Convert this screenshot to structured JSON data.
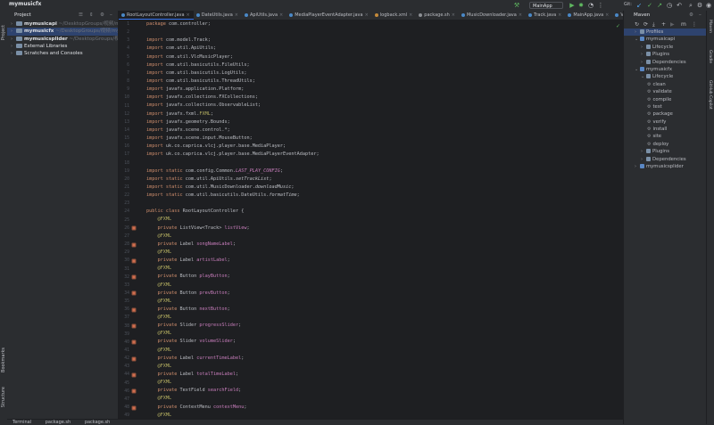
{
  "window": {
    "title": "mymusicfx"
  },
  "toolbar": {
    "run_config": "MainApp",
    "git_label": "Git:"
  },
  "left_strip": {
    "project": "Project",
    "structure": "Structure",
    "bookmarks": "Bookmarks"
  },
  "project_panel": {
    "header": "Project",
    "items": [
      {
        "name": "mymusicapi",
        "path": " ~/DesktopGroups/视频/mym",
        "indent": 0,
        "expanded": false,
        "selected": false
      },
      {
        "name": "mymusicfx",
        "path": " ~/DesktopGroups/视频/mym",
        "indent": 0,
        "expanded": false,
        "selected": true
      },
      {
        "name": "mymusicsplider",
        "path": " ~/DesktopGroups/视频/m",
        "indent": 0,
        "expanded": false,
        "selected": false
      },
      {
        "name": "External Libraries",
        "path": "",
        "indent": 0,
        "expanded": false,
        "selected": false
      },
      {
        "name": "Scratches and Consoles",
        "path": "",
        "indent": 0,
        "expanded": false,
        "selected": false
      }
    ]
  },
  "tabs": [
    {
      "label": "RootLayoutController.java",
      "active": true,
      "color": "#4a88c7"
    },
    {
      "label": "DateUtils.java",
      "active": false,
      "color": "#4a88c7"
    },
    {
      "label": "ApiUtils.java",
      "active": false,
      "color": "#4a88c7"
    },
    {
      "label": "MediaPlayerEventAdapter.java",
      "active": false,
      "color": "#4a88c7"
    },
    {
      "label": "logback.xml",
      "active": false,
      "color": "#c58a3a"
    },
    {
      "label": "package.sh",
      "active": false,
      "color": "#8c8f94"
    },
    {
      "label": "MusicDownloader.java",
      "active": false,
      "color": "#4a88c7"
    },
    {
      "label": "Track.java",
      "active": false,
      "color": "#4a88c7"
    },
    {
      "label": "MainApp.java",
      "active": false,
      "color": "#4a88c7"
    },
    {
      "label": "VlcMusic",
      "active": false,
      "color": "#4a88c7"
    }
  ],
  "code_lines": [
    {
      "n": "1",
      "html": "<span class=\"kw\">package</span> com.controller;"
    },
    {
      "n": "2",
      "html": ""
    },
    {
      "n": "3",
      "html": "<span class=\"kw\">import</span> com.model.Track;"
    },
    {
      "n": "4",
      "html": "<span class=\"kw\">import</span> com.util.ApiUtils;"
    },
    {
      "n": "5",
      "html": "<span class=\"kw\">import</span> com.util.VlcMusicPlayer;"
    },
    {
      "n": "6",
      "html": "<span class=\"kw\">import</span> com.util.basicutils.FileUtils;"
    },
    {
      "n": "7",
      "html": "<span class=\"kw\">import</span> com.util.basicutils.LogUtils;"
    },
    {
      "n": "8",
      "html": "<span class=\"kw\">import</span> com.util.basicutils.ThreadUtils;"
    },
    {
      "n": "9",
      "html": "<span class=\"kw\">import</span> javafx.application.Platform;"
    },
    {
      "n": "10",
      "html": "<span class=\"kw\">import</span> javafx.collections.FXCollections;"
    },
    {
      "n": "11",
      "html": "<span class=\"kw\">import</span> javafx.collections.ObservableList;"
    },
    {
      "n": "12",
      "html": "<span class=\"kw\">import</span> javafx.fxml.<span class=\"ann\">FXML</span>;"
    },
    {
      "n": "13",
      "html": "<span class=\"kw\">import</span> javafx.geometry.Bounds;"
    },
    {
      "n": "14",
      "html": "<span class=\"kw\">import</span> javafx.scene.control.*;"
    },
    {
      "n": "15",
      "html": "<span class=\"kw\">import</span> javafx.scene.input.MouseButton;"
    },
    {
      "n": "16",
      "html": "<span class=\"kw\">import</span> uk.co.caprica.vlcj.player.base.MediaPlayer;"
    },
    {
      "n": "17",
      "html": "<span class=\"kw\">import</span> uk.co.caprica.vlcj.player.base.MediaPlayerEventAdapter;"
    },
    {
      "n": "18",
      "html": ""
    },
    {
      "n": "19",
      "html": "<span class=\"kw\">import static</span> com.config.Common.<span class=\"fld ital\">LAST_PLAY_CONFIG</span>;"
    },
    {
      "n": "20",
      "html": "<span class=\"kw\">import static</span> com.util.ApiUtils.<span class=\"ital\">setTrackList</span>;"
    },
    {
      "n": "21",
      "html": "<span class=\"kw\">import static</span> com.util.MusicDownloader.<span class=\"ital\">downloadMusic</span>;"
    },
    {
      "n": "22",
      "html": "<span class=\"kw\">import static</span> com.util.basicutils.DateUtils.<span class=\"ital\">formatTime</span>;"
    },
    {
      "n": "23",
      "html": ""
    },
    {
      "n": "24",
      "html": "<span class=\"kw\">public class</span> RootLayoutController {"
    },
    {
      "n": "25",
      "html": "    <span class=\"ann\">@FXML</span>"
    },
    {
      "n": "26",
      "html": "    <span class=\"kw\">private</span> ListView&lt;Track&gt; <span class=\"fld\">listView</span>;",
      "icon": true
    },
    {
      "n": "27",
      "html": "    <span class=\"ann\">@FXML</span>"
    },
    {
      "n": "28",
      "html": "    <span class=\"kw\">private</span> Label <span class=\"fld\">songNameLabel</span>;",
      "icon": true
    },
    {
      "n": "29",
      "html": "    <span class=\"ann\">@FXML</span>"
    },
    {
      "n": "30",
      "html": "    <span class=\"kw\">private</span> Label <span class=\"fld\">artistLabel</span>;",
      "icon": true
    },
    {
      "n": "31",
      "html": "    <span class=\"ann\">@FXML</span>"
    },
    {
      "n": "32",
      "html": "    <span class=\"kw\">private</span> Button <span class=\"fld\">playButton</span>;",
      "icon": true
    },
    {
      "n": "33",
      "html": "    <span class=\"ann\">@FXML</span>"
    },
    {
      "n": "34",
      "html": "    <span class=\"kw\">private</span> Button <span class=\"fld\">prevButton</span>;",
      "icon": true
    },
    {
      "n": "35",
      "html": "    <span class=\"ann\">@FXML</span>"
    },
    {
      "n": "36",
      "html": "    <span class=\"kw\">private</span> Button <span class=\"fld\">nextButton</span>;",
      "icon": true
    },
    {
      "n": "37",
      "html": "    <span class=\"ann\">@FXML</span>"
    },
    {
      "n": "38",
      "html": "    <span class=\"kw\">private</span> Slider <span class=\"fld\">progressSlider</span>;",
      "icon": true
    },
    {
      "n": "39",
      "html": "    <span class=\"ann\">@FXML</span>"
    },
    {
      "n": "40",
      "html": "    <span class=\"kw\">private</span> Slider <span class=\"fld\">volumeSlider</span>;",
      "icon": true
    },
    {
      "n": "41",
      "html": "    <span class=\"ann\">@FXML</span>"
    },
    {
      "n": "42",
      "html": "    <span class=\"kw\">private</span> Label <span class=\"fld\">currentTimeLabel</span>;",
      "icon": true
    },
    {
      "n": "43",
      "html": "    <span class=\"ann\">@FXML</span>"
    },
    {
      "n": "44",
      "html": "    <span class=\"kw\">private</span> Label <span class=\"fld\">totalTimeLabel</span>;",
      "icon": true
    },
    {
      "n": "45",
      "html": "    <span class=\"ann\">@FXML</span>"
    },
    {
      "n": "46",
      "html": "    <span class=\"kw\">private</span> TextField <span class=\"fld\">searchField</span>;",
      "icon": true
    },
    {
      "n": "47",
      "html": "    <span class=\"ann\">@FXML</span>"
    },
    {
      "n": "48",
      "html": "    <span class=\"kw\">private</span> ContextMenu <span class=\"fld\">contextMenu</span>;",
      "icon": true
    },
    {
      "n": "49",
      "html": "    <span class=\"ann\">@FXML</span>"
    }
  ],
  "maven": {
    "header": "Maven",
    "items": [
      {
        "label": "Profiles",
        "indent": 0,
        "arrow": "›",
        "kind": "folder",
        "selected": true
      },
      {
        "label": "mymusicapi",
        "indent": 0,
        "arrow": "⌄",
        "kind": "module",
        "selected": false
      },
      {
        "label": "Lifecycle",
        "indent": 1,
        "arrow": "›",
        "kind": "folder",
        "selected": false
      },
      {
        "label": "Plugins",
        "indent": 1,
        "arrow": "›",
        "kind": "folder",
        "selected": false
      },
      {
        "label": "Dependencies",
        "indent": 1,
        "arrow": "›",
        "kind": "folder",
        "selected": false
      },
      {
        "label": "mymusicfx",
        "indent": 0,
        "arrow": "⌄",
        "kind": "module",
        "selected": false
      },
      {
        "label": "Lifecycle",
        "indent": 1,
        "arrow": "⌄",
        "kind": "folder",
        "selected": false
      },
      {
        "label": "clean",
        "indent": 2,
        "arrow": "",
        "kind": "goal",
        "selected": false
      },
      {
        "label": "validate",
        "indent": 2,
        "arrow": "",
        "kind": "goal",
        "selected": false
      },
      {
        "label": "compile",
        "indent": 2,
        "arrow": "",
        "kind": "goal",
        "selected": false
      },
      {
        "label": "test",
        "indent": 2,
        "arrow": "",
        "kind": "goal",
        "selected": false
      },
      {
        "label": "package",
        "indent": 2,
        "arrow": "",
        "kind": "goal",
        "selected": false
      },
      {
        "label": "verify",
        "indent": 2,
        "arrow": "",
        "kind": "goal",
        "selected": false
      },
      {
        "label": "install",
        "indent": 2,
        "arrow": "",
        "kind": "goal",
        "selected": false
      },
      {
        "label": "site",
        "indent": 2,
        "arrow": "",
        "kind": "goal",
        "selected": false
      },
      {
        "label": "deploy",
        "indent": 2,
        "arrow": "",
        "kind": "goal",
        "selected": false
      },
      {
        "label": "Plugins",
        "indent": 1,
        "arrow": "›",
        "kind": "folder",
        "selected": false
      },
      {
        "label": "Dependencies",
        "indent": 1,
        "arrow": "›",
        "kind": "folder",
        "selected": false
      },
      {
        "label": "mymusicsplider",
        "indent": 0,
        "arrow": "›",
        "kind": "module",
        "selected": false
      }
    ]
  },
  "right_strip": {
    "maven": "Maven",
    "gradle": "Gradle",
    "github": "GitHub Copilot"
  },
  "bottom_bar": {
    "terminal": "Terminal",
    "tab1": "package.sh",
    "tab2": "package.sh"
  },
  "colors": {
    "accent": "#3574f0",
    "keyword": "#cf8e6d",
    "field": "#c77dbb",
    "annotation": "#b3ae60",
    "editor_bg": "#1e1f22",
    "panel_bg": "#2b2d30"
  }
}
